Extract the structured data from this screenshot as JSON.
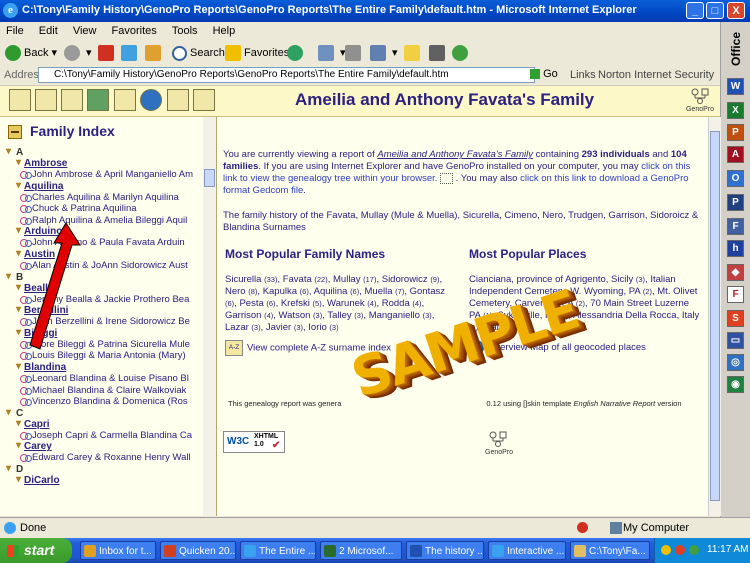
{
  "window": {
    "title": "C:\\Tony\\Family History\\GenoPro Reports\\GenoPro Reports\\The Entire Family\\default.htm - Microsoft Internet Explorer",
    "icon": "ie-icon",
    "min_label": "_",
    "max_label": "□",
    "close_label": "X"
  },
  "menu": [
    "File",
    "Edit",
    "View",
    "Favorites",
    "Tools",
    "Help"
  ],
  "toolbar": {
    "back": "Back",
    "search": "Search",
    "favorites": "Favorites"
  },
  "address": {
    "label": "Address",
    "value": "C:\\Tony\\Family History\\GenoPro Reports\\GenoPro Reports\\The Entire Family\\default.htm",
    "go": "Go",
    "links": "Links",
    "norton": "Norton Internet Security"
  },
  "office_bar": {
    "title": "Office"
  },
  "page": {
    "title": "Ameilia and Anthony Favata's Family",
    "logo_text": "GenoPro"
  },
  "index": {
    "title": "Family Index",
    "groups": [
      {
        "letter": "A",
        "families": [
          {
            "name": "Ambrose",
            "couples": [
              "John Ambrose & April Manganiello Am"
            ]
          },
          {
            "name": "Aquilina",
            "couples": [
              "Charles Aquilina & Marilyn Aquilina",
              "Chuck & Patrina Aquilina",
              "Ralph Aquilina & Amelia Bileggi Aquil"
            ]
          },
          {
            "name": "Arduino",
            "couples": [
              "John Arduino &  Paula Favata Arduin"
            ]
          },
          {
            "name": "Austin",
            "couples": [
              "Alan Austin & JoAnn Sidorowicz Aust"
            ]
          }
        ]
      },
      {
        "letter": "B",
        "families": [
          {
            "name": "Bealla",
            "couples": [
              "Jeremy Bealla & Jackie Prothero Bea"
            ]
          },
          {
            "name": "Berzellini",
            "couples": [
              "John Berzellini & Irene Sidorowicz Be"
            ]
          },
          {
            "name": "Bileggi",
            "couples": [
              "Etore Bileggi & Patrina Sicurella Mule",
              "Louis Bileggi & Maria Antonia (Mary)"
            ]
          },
          {
            "name": "Blandina",
            "couples": [
              "Leonard Blandina & Louise Pisano Bl",
              "Michael Blandina & Claire Walkoviak",
              "Vincenzo Blandina & Domenica (Ros"
            ]
          }
        ]
      },
      {
        "letter": "C",
        "families": [
          {
            "name": "Capri",
            "couples": [
              "Joseph Capri & Carmella Blandina Ca"
            ]
          },
          {
            "name": "Carey",
            "couples": [
              "Edward Carey & Roxanne Henry Wall"
            ]
          }
        ]
      },
      {
        "letter": "D",
        "families": [
          {
            "name": "DiCarlo",
            "couples": []
          }
        ]
      }
    ]
  },
  "intro": {
    "p1_a": "You are currently viewing a report of ",
    "p1_link": "Ameilia and Anthony Favata's Family",
    "p1_b": " containing ",
    "individuals": "293 individuals",
    "p1_and": " and ",
    "families": "104 families",
    "p1_c": ". If you are using Internet Explorer and have GenoPro installed on your computer, you may ",
    "p1_link2": "click on this link to view the genealogy tree within your browser.",
    "p1_d": " . You may also ",
    "p1_link3": "click on this link to download a GenoPro format Gedcom file",
    "p1_end": ".",
    "history": "The family history of the Favata, Mullay (Mule & Muella), Sicurella, Cimeno, Nero, Trudgen, Garrison, Sidoroicz & Blandina Surnames"
  },
  "names": {
    "title": "Most Popular Family Names",
    "items": [
      {
        "n": "Sicurella",
        "c": "(33)"
      },
      {
        "n": "Favata",
        "c": "(22)"
      },
      {
        "n": "Mullay",
        "c": "(17)"
      },
      {
        "n": "Sidorowicz",
        "c": "(9)"
      },
      {
        "n": "Nero",
        "c": "(8)"
      },
      {
        "n": "Kapulka",
        "c": "(6)"
      },
      {
        "n": "Aquilina",
        "c": "(6)"
      },
      {
        "n": "Muella",
        "c": "(7)"
      },
      {
        "n": "Gontasz",
        "c": "(6)"
      },
      {
        "n": "Pesta",
        "c": "(6)"
      },
      {
        "n": "Krefski",
        "c": "(5)"
      },
      {
        "n": "Warunek",
        "c": "(4)"
      },
      {
        "n": "Rodda",
        "c": "(4)"
      },
      {
        "n": "Garrison",
        "c": "(4)"
      },
      {
        "n": "Watson",
        "c": "(3)"
      },
      {
        "n": "Talley",
        "c": "(3)"
      },
      {
        "n": "Manganiello",
        "c": "(3)"
      },
      {
        "n": "Lazar",
        "c": "(3)"
      },
      {
        "n": "Javier",
        "c": "(3)"
      },
      {
        "n": "Iorio",
        "c": "(3)"
      }
    ],
    "az_icon": "A-Z",
    "az_link": "View complete A-Z surname index"
  },
  "places": {
    "title": "Most Popular Places",
    "items": [
      {
        "n": "Cianciana, province of Agrigento, Sicily",
        "c": "(3)"
      },
      {
        "n": "Italian Independent Cemetery, W. Wyoming, PA",
        "c": "(2)"
      },
      {
        "n": "Mt. Olivet Cemetery, Carverton, PA",
        "c": "(2)"
      },
      {
        "n": "70 Main Street Luzerne PA",
        "c": "(1)"
      },
      {
        "n": "Sykesville, PA",
        "c": "(1)"
      },
      {
        "n": "Alessandria Della Rocca, Italy",
        "c": "(1)"
      },
      {
        "n": "Alabama",
        "c": "(1)"
      }
    ],
    "map_link": "Overview Map of all geocoded places"
  },
  "footer": {
    "left": "This genealogy report was genera",
    "right": "0.12 using []skin template ",
    "template": "English Narrative Report",
    "end": " version"
  },
  "badges": {
    "w3c": "W3C",
    "xhtml": "XHTML 1.0"
  },
  "watermark": "SAMPLE",
  "status": {
    "done": "Done",
    "zone": "My Computer"
  },
  "taskbar": {
    "start": "start",
    "tasks": [
      {
        "label": "Inbox for t...",
        "color": "#e0a020"
      },
      {
        "label": "Quicken 20...",
        "color": "#d04020"
      },
      {
        "label": "The Entire ...",
        "color": "#3aa0f0"
      },
      {
        "label": "2 Microsof...",
        "color": "#2a6a2a"
      },
      {
        "label": "The history ...",
        "color": "#2050b0"
      },
      {
        "label": "Interactive ...",
        "color": "#3aa0f0"
      },
      {
        "label": "C:\\Tony\\Fa...",
        "color": "#e0c060"
      }
    ],
    "clock": "11:17 AM"
  },
  "colors": {
    "title_blue": "#2c2080",
    "page_bg": "#ffffee",
    "header_bg": "#fdf8c8"
  }
}
